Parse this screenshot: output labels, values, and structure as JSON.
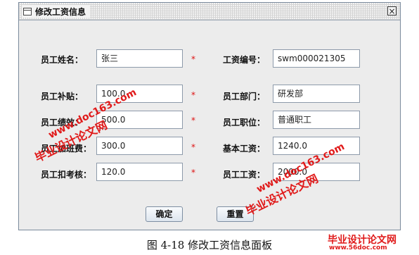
{
  "window": {
    "title": "修改工资信息",
    "close_glyph": "×"
  },
  "form": {
    "left": [
      {
        "label": "员工姓名：",
        "value": "张三",
        "required": "*"
      },
      {
        "label": "员工补贴：",
        "value": "100.0",
        "required": "*"
      },
      {
        "label": "员工绩效：",
        "value": "500.0",
        "required": "*"
      },
      {
        "label": "员工加班费：",
        "value": "300.0",
        "required": "*"
      },
      {
        "label": "员工扣考核：",
        "value": "120.0",
        "required": "*"
      }
    ],
    "right": [
      {
        "label": "工资编号：",
        "value": "swm000021305"
      },
      {
        "label": "员工部门：",
        "value": "研发部"
      },
      {
        "label": "员工职位：",
        "value": "普通职工"
      },
      {
        "label": "基本工资：",
        "value": "1240.0"
      },
      {
        "label": "员工工资：",
        "value": "2000.0"
      }
    ]
  },
  "buttons": {
    "confirm": "确定",
    "reset": "重置"
  },
  "caption": "图 4-18  修改工资信息面板",
  "watermark": {
    "site_cn": "毕业设计论文网",
    "site_url": "www.doc163.com",
    "site_url2": "www.56doc.com",
    "color": "#e01a1a"
  }
}
